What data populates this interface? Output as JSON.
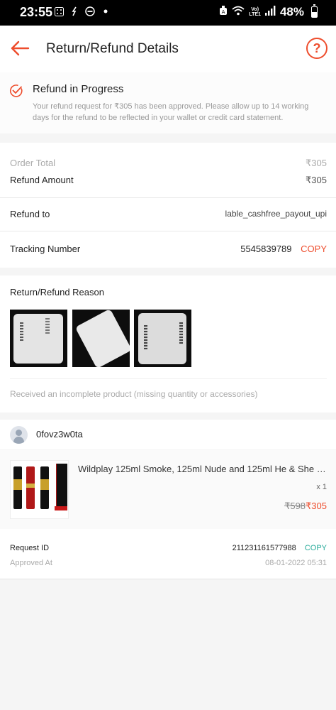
{
  "status_bar": {
    "time": "23:55",
    "lte_top": "Vo)",
    "lte_bottom": "LTE1",
    "battery": "48%",
    "battery_level": 0.48
  },
  "header": {
    "title": "Return/Refund Details",
    "help_glyph": "?"
  },
  "progress": {
    "title": "Refund in Progress",
    "description": "Your refund request for ₹305 has been approved. Please allow up to 14 working days for the refund to be reflected in your wallet or credit card statement."
  },
  "totals": {
    "order_total_label": "Order Total",
    "order_total_value": "₹305",
    "refund_amount_label": "Refund Amount",
    "refund_amount_value": "₹305",
    "refund_to_label": "Refund to",
    "refund_to_value": "lable_cashfree_payout_upi",
    "tracking_label": "Tracking Number",
    "tracking_value": "5545839789",
    "copy_label": "COPY"
  },
  "reason": {
    "title": "Return/Refund Reason",
    "text": "Received an incomplete product (missing quantity or accessories)"
  },
  "shop": {
    "name": "0fovz3w0ta"
  },
  "product": {
    "name": "Wildplay 125ml Smoke, 125ml Nude and 125ml He & She Sp...",
    "qty": "x 1",
    "old_price": "₹598",
    "new_price": "₹305"
  },
  "request": {
    "request_id_label": "Request ID",
    "request_id_value": "211231161577988",
    "copy_label": "COPY",
    "approved_label": "Approved At",
    "approved_value": "08-01-2022 05:31"
  },
  "colors": {
    "accent": "#ee4d2d",
    "copy_green": "#26aa99"
  },
  "icons": [
    "back-arrow-icon",
    "help-icon",
    "check-circle-icon",
    "user-avatar-icon"
  ]
}
